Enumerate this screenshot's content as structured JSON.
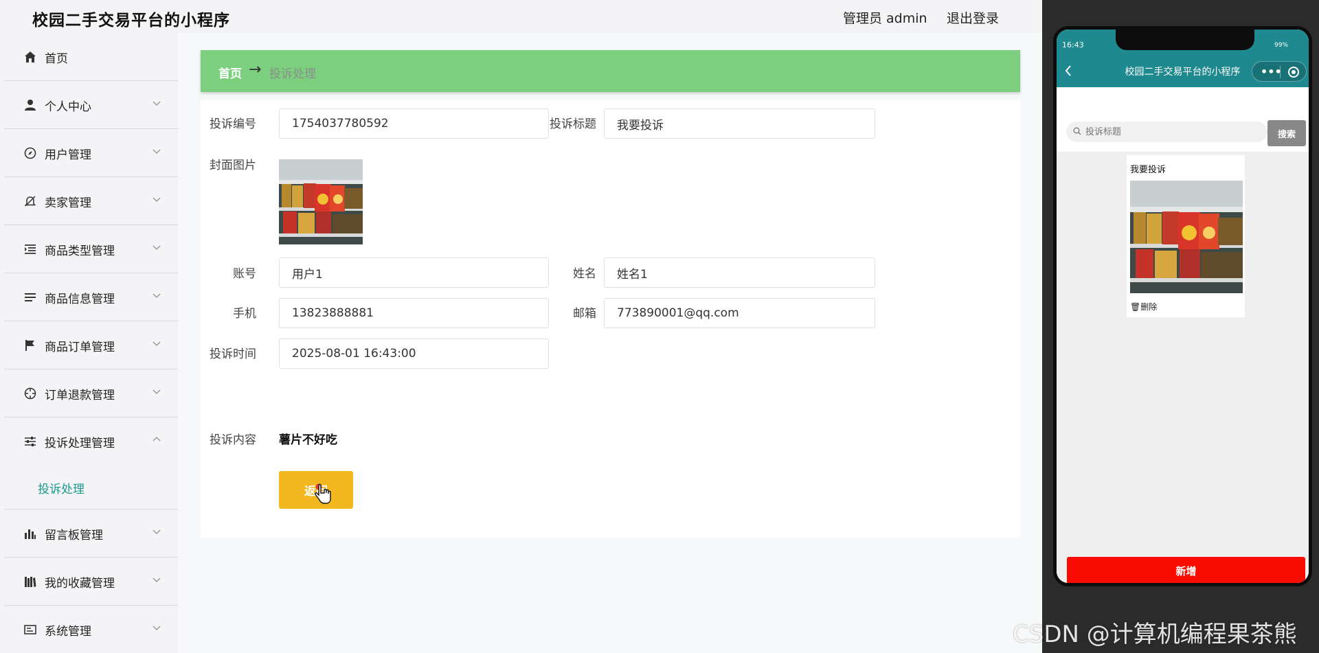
{
  "app": {
    "title": "校园二手交易平台的小程序"
  },
  "header": {
    "admin_label": "管理员 admin",
    "logout_label": "退出登录"
  },
  "sidebar": {
    "items": [
      {
        "label": "首页",
        "icon": "home-icon"
      },
      {
        "label": "个人中心",
        "icon": "user-icon"
      },
      {
        "label": "用户管理",
        "icon": "compass-icon"
      },
      {
        "label": "卖家管理",
        "icon": "bell-off-icon"
      },
      {
        "label": "商品类型管理",
        "icon": "list-indent-icon"
      },
      {
        "label": "商品信息管理",
        "icon": "list-icon"
      },
      {
        "label": "商品订单管理",
        "icon": "flag-icon"
      },
      {
        "label": "订单退款管理",
        "icon": "crosshair-icon"
      },
      {
        "label": "投诉处理管理",
        "icon": "sliders-icon"
      },
      {
        "label": "留言板管理",
        "icon": "bar-chart-icon"
      },
      {
        "label": "我的收藏管理",
        "icon": "books-icon"
      },
      {
        "label": "系统管理",
        "icon": "card-icon"
      }
    ],
    "sub_item": "投诉处理",
    "accent_color": "#1a9b8e"
  },
  "breadcrumb": {
    "home": "首页",
    "arrow": "→",
    "current": "投诉处理",
    "bar_color": "#7bcf7e"
  },
  "form": {
    "labels": {
      "complaint_no": "投诉编号",
      "complaint_title": "投诉标题",
      "cover": "封面图片",
      "account": "账号",
      "name": "姓名",
      "phone": "手机",
      "email": "邮箱",
      "time": "投诉时间",
      "content": "投诉内容"
    },
    "values": {
      "complaint_no": "1754037780592",
      "complaint_title": "我要投诉",
      "account": "用户1",
      "name": "姓名1",
      "phone": "13823888881",
      "email": "773890001@qq.com",
      "time": "2025-08-01 16:43:00",
      "content": "薯片不好吃"
    },
    "back_button": "返回",
    "back_button_color": "#f3b71f"
  },
  "phone": {
    "time": "16:43",
    "battery": "99%",
    "title": "校园二手交易平台的小程序",
    "search_placeholder": "投诉标题",
    "search_button": "搜索",
    "card_title": "我要投诉",
    "delete_label": "删除",
    "add_button": "新增",
    "nav_color": "#1e8a8f",
    "add_color": "#f80b00"
  },
  "watermark": "CSDN @计算机编程果茶熊"
}
